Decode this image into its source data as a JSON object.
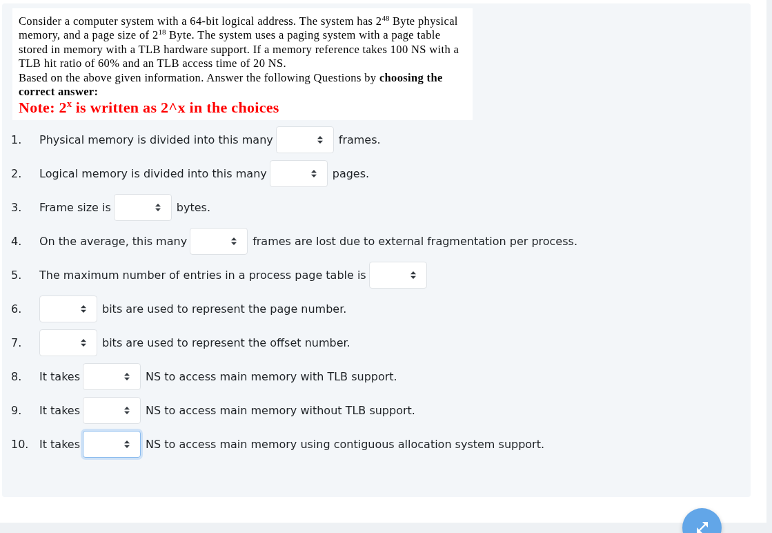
{
  "question_card": {
    "paragraphs": [
      "Consider a computer system with a 64-bit logical address. The system has 2$^{48}$ Byte physical memory, and a page size of 2$^{18}$ Byte. The system uses a paging system with a page table stored in memory with a TLB hardware support. If a memory reference takes 100 NS with a TLB hit ratio of 60% and an TLB access time of 20 NS.",
      "Based on the above given information. Answer the following Questions by **choosing the correct answer:**"
    ],
    "note": "Note: 2$^{x}$ is written as 2^x in the choices"
  },
  "questions": [
    {
      "number": "1.",
      "parts": [
        {
          "kind": "text",
          "text": "Physical memory is divided into this many"
        },
        {
          "kind": "select",
          "focused": false
        },
        {
          "kind": "text",
          "text": "frames."
        }
      ]
    },
    {
      "number": "2.",
      "parts": [
        {
          "kind": "text",
          "text": "Logical memory is divided into this many"
        },
        {
          "kind": "select",
          "focused": false
        },
        {
          "kind": "text",
          "text": "pages."
        }
      ]
    },
    {
      "number": "3.",
      "parts": [
        {
          "kind": "text",
          "text": "Frame size is"
        },
        {
          "kind": "select",
          "focused": false
        },
        {
          "kind": "text",
          "text": "bytes."
        }
      ]
    },
    {
      "number": "4.",
      "parts": [
        {
          "kind": "text",
          "text": "On the average, this many"
        },
        {
          "kind": "select",
          "focused": false
        },
        {
          "kind": "text",
          "text": "frames are lost due to external fragmentation per process."
        }
      ]
    },
    {
      "number": "5.",
      "parts": [
        {
          "kind": "text",
          "text": "The maximum number of entries in a process page table is"
        },
        {
          "kind": "select",
          "focused": false
        }
      ]
    },
    {
      "number": "6.",
      "parts": [
        {
          "kind": "select",
          "focused": false
        },
        {
          "kind": "text",
          "text": "bits are used to represent the page number."
        }
      ]
    },
    {
      "number": "7.",
      "parts": [
        {
          "kind": "select",
          "focused": false
        },
        {
          "kind": "text",
          "text": "bits are used to represent the offset number."
        }
      ]
    },
    {
      "number": "8.",
      "parts": [
        {
          "kind": "text",
          "text": "It takes"
        },
        {
          "kind": "select",
          "focused": false
        },
        {
          "kind": "text",
          "text": "NS to access main memory with TLB support."
        }
      ]
    },
    {
      "number": "9.",
      "parts": [
        {
          "kind": "text",
          "text": "It takes"
        },
        {
          "kind": "select",
          "focused": false
        },
        {
          "kind": "text",
          "text": "NS to access main memory without TLB support."
        }
      ]
    },
    {
      "number": "10.",
      "parts": [
        {
          "kind": "text",
          "text": "It takes"
        },
        {
          "kind": "select",
          "focused": true
        },
        {
          "kind": "text",
          "text": "NS to access main memory using contiguous allocation system support."
        }
      ]
    }
  ]
}
